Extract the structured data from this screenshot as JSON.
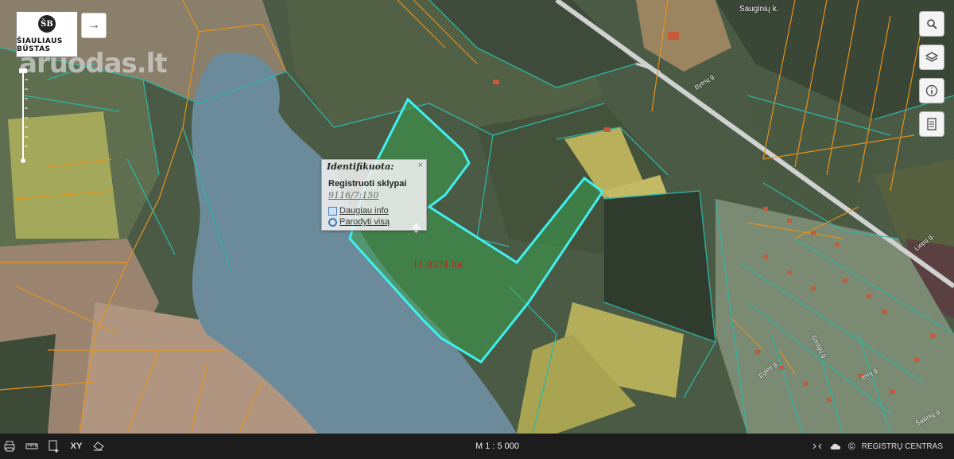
{
  "logo": {
    "text": "ŠIAULIAUS BŪSTAS",
    "emblem": "ŠB"
  },
  "watermark": "aruodas.lt",
  "popup": {
    "title": "Identifikuota:",
    "close_glyph": "×",
    "layer": "Registruoti sklypai",
    "parcel_id": "9116/7:150",
    "link_more": "Daugiau info",
    "link_show": "Parodyti visą",
    "link_more_icon": "document-icon",
    "link_show_icon": "magnifier-icon"
  },
  "parcel_area": "11,0274 ha",
  "place_labels": {
    "village": "Sauginių k.",
    "street_1": "Bytrių g.",
    "street_2": "Liepų g.",
    "street_3": "Eglės g.",
    "street_4": "Smilgų g.",
    "street_5": "Ievų g.",
    "street_6": "Šaltinių g."
  },
  "right_tools": [
    {
      "name": "search",
      "icon": "search-icon"
    },
    {
      "name": "layers",
      "icon": "layers-icon"
    },
    {
      "name": "info",
      "icon": "info-icon"
    },
    {
      "name": "legend",
      "icon": "document-icon"
    }
  ],
  "bottom_bar": {
    "scale": "M 1 : 5 000",
    "coord_label": "XY",
    "brand": "REGISTRŲ CENTRAS",
    "copyright_glyph": "©",
    "tools": [
      "print-icon",
      "ruler-icon",
      "add-document-icon",
      "xy-icon",
      "eraser-icon"
    ]
  },
  "colors": {
    "parcel_outline": "#40f0f0",
    "parcel_boundaries": "#2fb5a5",
    "cadastre_lines": "#e8921a",
    "water": "#6b8a9a",
    "area_label": "#d01818"
  }
}
